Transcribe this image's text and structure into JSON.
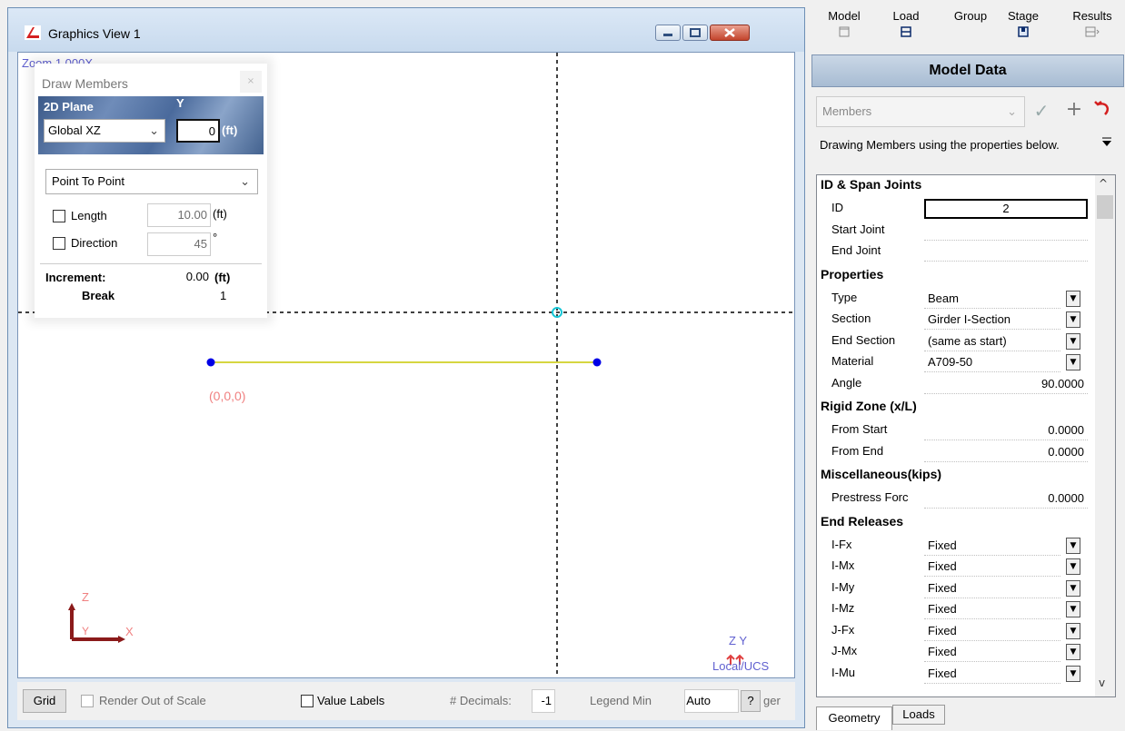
{
  "window": {
    "title": "Graphics View 1"
  },
  "canvas": {
    "zoom_label": "Zoom  1.000X",
    "origin_label": "(0,0,0)",
    "axis_z": "Z",
    "axis_y": "Y",
    "axis_x": "X",
    "ucs_axes": "Z Y",
    "ucs_label": "Local/UCS"
  },
  "draw_members": {
    "title": "Draw Members",
    "plane_label": "2D Plane",
    "y_label": "Y",
    "plane_value": "Global XZ",
    "y_value": "0",
    "y_unit": "(ft)",
    "mode": "Point To Point",
    "length_label": "Length",
    "length_value": "10.00",
    "length_unit": "(ft)",
    "direction_label": "Direction",
    "direction_value": "45",
    "direction_unit": "°",
    "increment_label": "Increment:",
    "increment_value": "0.00",
    "increment_unit": "(ft)",
    "break_label": "Break",
    "break_value": "1"
  },
  "bottom": {
    "grid": "Grid",
    "render_out_of_scale": "Render Out of Scale",
    "value_labels": "Value Labels",
    "decimals_label": "# Decimals:",
    "decimals_value": "-1",
    "legend_min": "Legend Min",
    "auto": "Auto",
    "help": "?",
    "ger": "ger"
  },
  "top_tabs": [
    "Model",
    "Load",
    "Group",
    "Stage",
    "Results"
  ],
  "model_data": {
    "title": "Model Data",
    "combo": "Members",
    "description": "Drawing Members using the properties below."
  },
  "grid": {
    "sections": [
      {
        "title": "ID & Span Joints",
        "rows": [
          {
            "label": "ID",
            "value": "2",
            "align": "center",
            "dropdown": false
          },
          {
            "label": "Start Joint",
            "value": "",
            "align": "left",
            "dropdown": false
          },
          {
            "label": "End Joint",
            "value": "",
            "align": "left",
            "dropdown": false
          }
        ]
      },
      {
        "title": "Properties",
        "rows": [
          {
            "label": "Type",
            "value": "Beam",
            "align": "left",
            "dropdown": true
          },
          {
            "label": "Section",
            "value": "Girder I-Section",
            "align": "left",
            "dropdown": true
          },
          {
            "label": "End Section",
            "value": "(same as start)",
            "align": "left",
            "dropdown": true
          },
          {
            "label": "Material",
            "value": "A709-50",
            "align": "left",
            "dropdown": true
          },
          {
            "label": "Angle",
            "value": "90.0000",
            "align": "right",
            "dropdown": false
          }
        ]
      },
      {
        "title": "Rigid Zone (x/L)",
        "rows": [
          {
            "label": "From Start",
            "value": "0.0000",
            "align": "right",
            "dropdown": false
          },
          {
            "label": "From End",
            "value": "0.0000",
            "align": "right",
            "dropdown": false
          }
        ]
      },
      {
        "title": "Miscellaneous(kips)",
        "rows": [
          {
            "label": "Prestress Forc",
            "value": "0.0000",
            "align": "right",
            "dropdown": false
          }
        ]
      },
      {
        "title": "End Releases",
        "rows": [
          {
            "label": "I-Fx",
            "value": "Fixed",
            "align": "left",
            "dropdown": true
          },
          {
            "label": "I-Mx",
            "value": "Fixed",
            "align": "left",
            "dropdown": true
          },
          {
            "label": "I-My",
            "value": "Fixed",
            "align": "left",
            "dropdown": true
          },
          {
            "label": "I-Mz",
            "value": "Fixed",
            "align": "left",
            "dropdown": true
          },
          {
            "label": "J-Fx",
            "value": "Fixed",
            "align": "left",
            "dropdown": true
          },
          {
            "label": "J-Mx",
            "value": "Fixed",
            "align": "left",
            "dropdown": true
          },
          {
            "label": "I-Mu",
            "value": "Fixed",
            "align": "left",
            "dropdown": true
          }
        ]
      }
    ]
  },
  "bottom_tabs": [
    "Geometry",
    "Loads"
  ],
  "colors": {
    "member": "#c8c800",
    "joint": "#0000e6",
    "cursor": "#16c6d6",
    "axis": "#8b1a1a",
    "label_red": "#f08080",
    "ucs": "#6060d0"
  }
}
